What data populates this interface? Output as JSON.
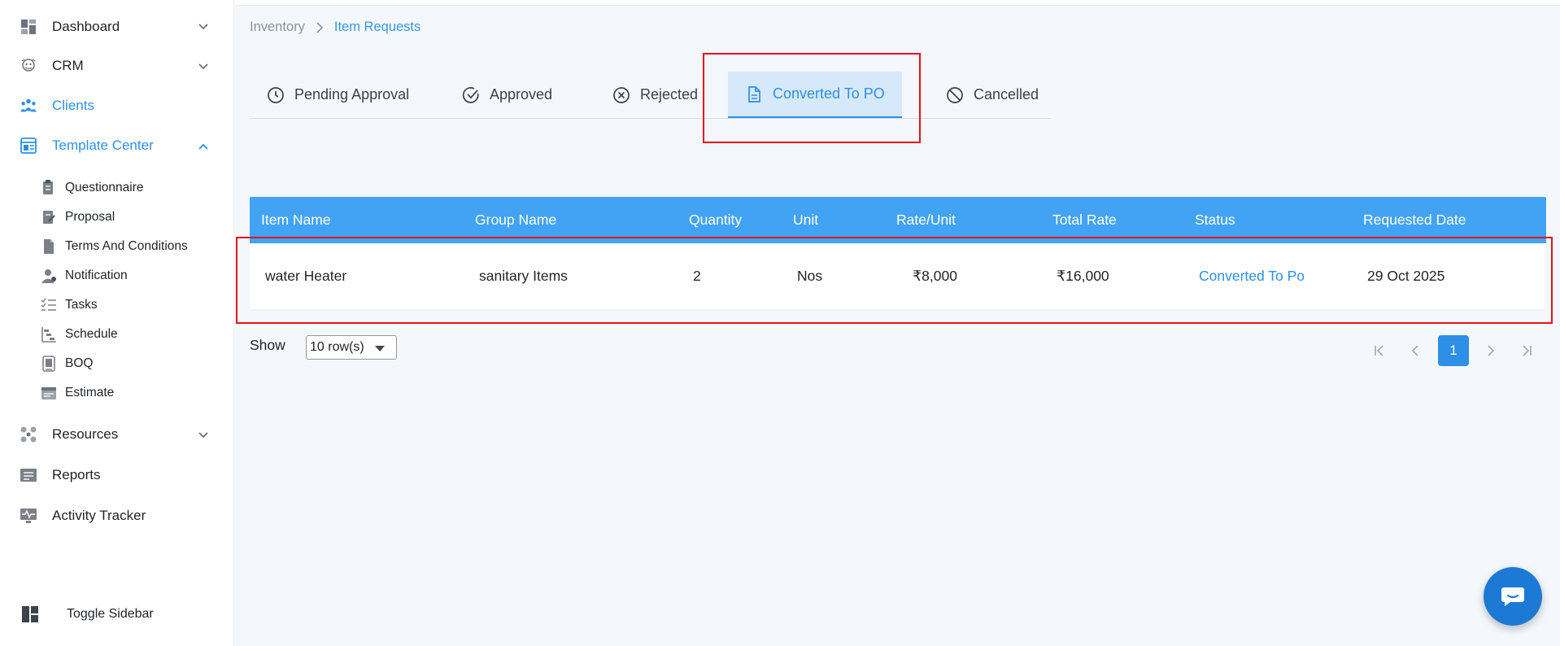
{
  "sidebar": {
    "items": [
      {
        "label": "Dashboard",
        "icon": "dashboard-icon",
        "expandable": true
      },
      {
        "label": "CRM",
        "icon": "crm-icon",
        "expandable": true
      },
      {
        "label": "Clients",
        "icon": "clients-icon",
        "active": true
      },
      {
        "label": "Template Center",
        "icon": "template-icon",
        "expanded": true
      },
      {
        "label": "Resources",
        "icon": "resources-icon",
        "expandable": true
      },
      {
        "label": "Reports",
        "icon": "reports-icon"
      },
      {
        "label": "Activity Tracker",
        "icon": "activity-icon"
      }
    ],
    "sub_items": [
      {
        "label": "Questionnaire",
        "icon": "questionnaire-icon"
      },
      {
        "label": "Proposal",
        "icon": "proposal-icon"
      },
      {
        "label": "Terms And Conditions",
        "icon": "document-icon"
      },
      {
        "label": "Notification",
        "icon": "user-icon"
      },
      {
        "label": "Tasks",
        "icon": "tasks-icon"
      },
      {
        "label": "Schedule",
        "icon": "schedule-icon"
      },
      {
        "label": "BOQ",
        "icon": "boq-icon"
      },
      {
        "label": "Estimate",
        "icon": "estimate-icon"
      }
    ],
    "toggle_label": "Toggle Sidebar"
  },
  "breadcrumb": {
    "parent": "Inventory",
    "current": "Item Requests"
  },
  "tabs": [
    {
      "label": "Pending Approval",
      "icon": "clock-icon"
    },
    {
      "label": "Approved",
      "icon": "check-circle-icon"
    },
    {
      "label": "Rejected",
      "icon": "x-circle-icon"
    },
    {
      "label": "Converted To PO",
      "icon": "file-icon",
      "active": true
    },
    {
      "label": "Cancelled",
      "icon": "ban-icon"
    }
  ],
  "table": {
    "columns": [
      "Item Name",
      "Group Name",
      "Quantity",
      "Unit",
      "Rate/Unit",
      "Total Rate",
      "Status",
      "Requested Date"
    ],
    "rows": [
      [
        "water Heater",
        "sanitary Items",
        "2",
        "Nos",
        "₹8,000",
        "₹16,000",
        "Converted To Po",
        "29 Oct 2025"
      ]
    ]
  },
  "pagination": {
    "show_label": "Show",
    "rows_option": "10 row(s)",
    "current_page": "1"
  },
  "colors": {
    "accent": "#2e8fe6",
    "header": "#42a3f4",
    "highlight": "#e5141a"
  }
}
